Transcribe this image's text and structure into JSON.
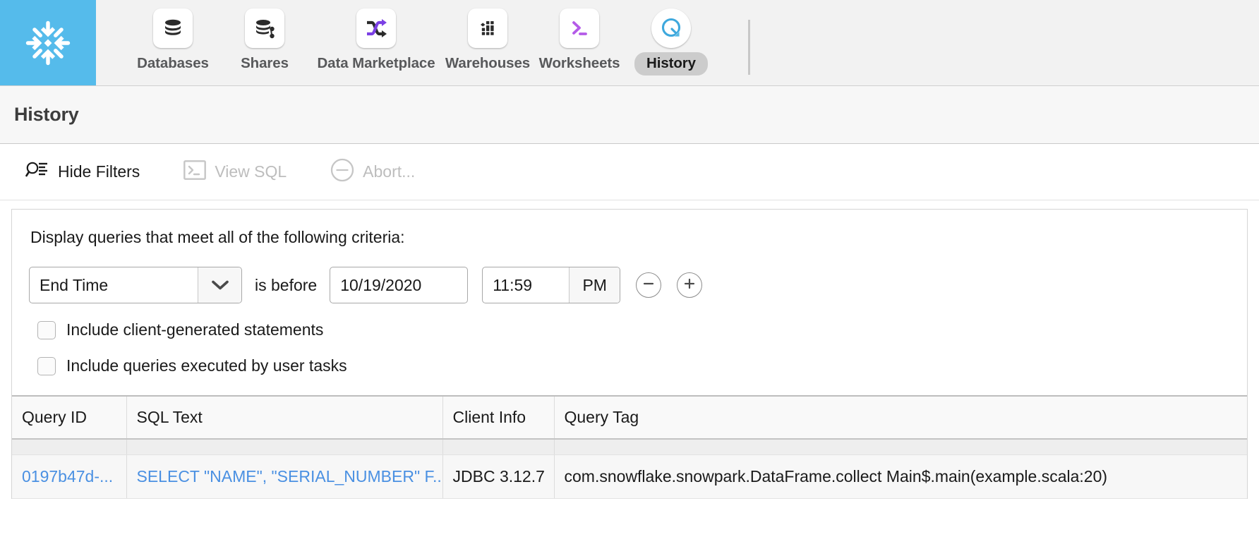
{
  "brand": {
    "logo_icon": "snowflake-logo",
    "logo_bg": "#55bbeb"
  },
  "topnav": {
    "items": [
      {
        "label": "Databases",
        "icon": "database-icon",
        "active": false
      },
      {
        "label": "Shares",
        "icon": "database-share-icon",
        "active": false
      },
      {
        "label": "Data Marketplace",
        "icon": "shuffle-arrows-icon",
        "active": false
      },
      {
        "label": "Warehouses",
        "icon": "warehouse-grid-icon",
        "active": false
      },
      {
        "label": "Worksheets",
        "icon": "terminal-prompt-icon",
        "active": false
      },
      {
        "label": "History",
        "icon": "history-refresh-icon",
        "active": true
      }
    ]
  },
  "page": {
    "title": "History"
  },
  "toolbar": {
    "buttons": [
      {
        "label": "Hide Filters",
        "icon": "filter-search-icon",
        "disabled": false
      },
      {
        "label": "View SQL",
        "icon": "terminal-prompt-icon",
        "disabled": true
      },
      {
        "label": "Abort...",
        "icon": "minus-circle-icon",
        "disabled": true
      }
    ]
  },
  "filters": {
    "heading": "Display queries that meet all of the following criteria:",
    "criterion": {
      "field": "End Time",
      "operator": "is before",
      "date": "10/19/2020",
      "time": "11:59",
      "ampm": "PM",
      "remove_icon": "minus-circle-icon",
      "add_icon": "plus-circle-icon"
    },
    "checkboxes": [
      {
        "label": "Include client-generated statements",
        "checked": false
      },
      {
        "label": "Include queries executed by user tasks",
        "checked": false
      }
    ]
  },
  "table": {
    "columns": [
      "Query ID",
      "SQL Text",
      "Client Info",
      "Query Tag"
    ],
    "rows": [
      {
        "query_id": "",
        "sql_text": "",
        "client_info": "",
        "query_tag": "",
        "clipped": true
      },
      {
        "query_id": "0197b47d-...",
        "sql_text": "SELECT \"NAME\", \"SERIAL_NUMBER\" F...",
        "client_info": "JDBC 3.12.7",
        "query_tag": "com.snowflake.snowpark.DataFrame.collect Main$.main(example.scala:20)",
        "clipped": false
      }
    ]
  },
  "colors": {
    "link": "#4a90e2",
    "accent": "#55bbeb",
    "purple": "#7b3fe4",
    "nav_bg": "#f2f2f2"
  }
}
